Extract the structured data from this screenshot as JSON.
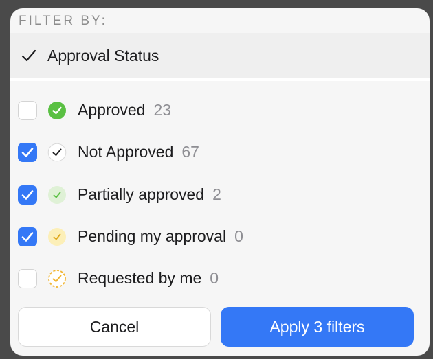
{
  "header": {
    "title": "FILTER BY:"
  },
  "section": {
    "label": "Approval Status"
  },
  "items": [
    {
      "label": "Approved",
      "count": "23",
      "checked": false,
      "icon": "approved-icon"
    },
    {
      "label": "Not Approved",
      "count": "67",
      "checked": true,
      "icon": "not-approved-icon"
    },
    {
      "label": "Partially approved",
      "count": "2",
      "checked": true,
      "icon": "partially-approved-icon"
    },
    {
      "label": "Pending my approval",
      "count": "0",
      "checked": true,
      "icon": "pending-approval-icon"
    },
    {
      "label": "Requested by me",
      "count": "0",
      "checked": false,
      "icon": "requested-by-me-icon"
    }
  ],
  "buttons": {
    "cancel_label": "Cancel",
    "apply_label": "Apply 3 filters"
  },
  "colors": {
    "accent": "#3478f6",
    "approved": "#5ac043",
    "partial": "#dff1d6",
    "pending": "#fcefb8",
    "requested": "#f2b632"
  }
}
